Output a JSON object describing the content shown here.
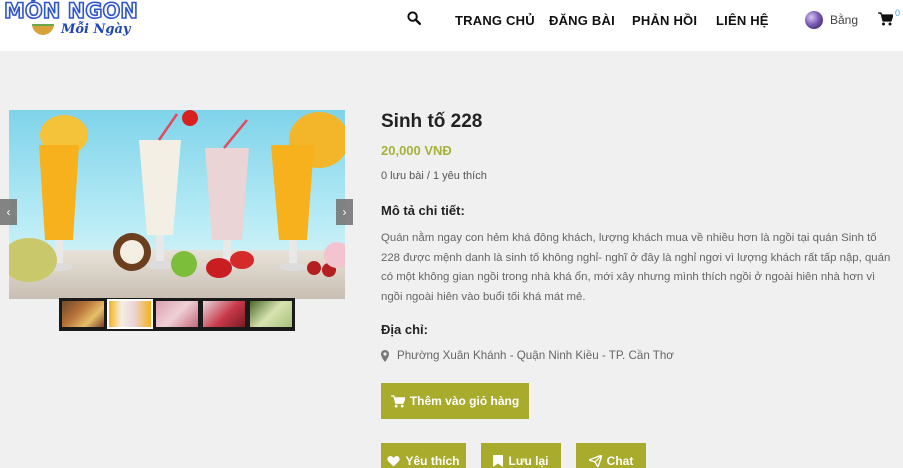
{
  "header": {
    "logo_line1": "MÓN NGON",
    "logo_line2": "Mỗi Ngày",
    "nav": [
      "TRANG CHỦ",
      "ĐĂNG BÀI",
      "PHẢN HỒI",
      "LIÊN HỆ"
    ],
    "user_name": "Bằng",
    "cart_count": "0",
    "icons": {
      "search": "search-icon",
      "cart": "cart-icon",
      "avatar": "avatar"
    }
  },
  "gallery": {
    "prev_label": "‹",
    "next_label": "›",
    "thumbnail_count": 5,
    "active_thumbnail": 2
  },
  "product": {
    "title": "Sinh tố 228",
    "price": "20,000 VNĐ",
    "stats": "0 lưu bài / 1 yêu thích",
    "desc_heading": "Mô tả chi tiết:",
    "description": "Quán nằm ngay con hẻm khá đông khách, lượng khách mua về nhiều hơn là ngồi tại quán Sinh tố 228 được mệnh danh là sinh tố không nghỉ- nghĩ ở đây là nghỉ ngơi vì lượng khách rất tấp nập, quán có một không gian ngồi trong nhà khá ổn, mới xây nhưng mình thích ngồi ở ngoài hiên nhà hơn vì ngồi ngoài hiên vào buổi tối khá mát mẻ.",
    "addr_heading": "Địa chỉ:",
    "address": "Phường Xuân Khánh - Quận Ninh Kiều - TP. Cần Thơ"
  },
  "actions": {
    "add_to_cart": "Thêm vào giỏ hàng",
    "like": "Yêu thích",
    "save": "Lưu lại",
    "chat": "Chat"
  },
  "colors": {
    "accent": "#a8ab2c",
    "price": "#a8b13a",
    "background": "#f0f0f0"
  }
}
